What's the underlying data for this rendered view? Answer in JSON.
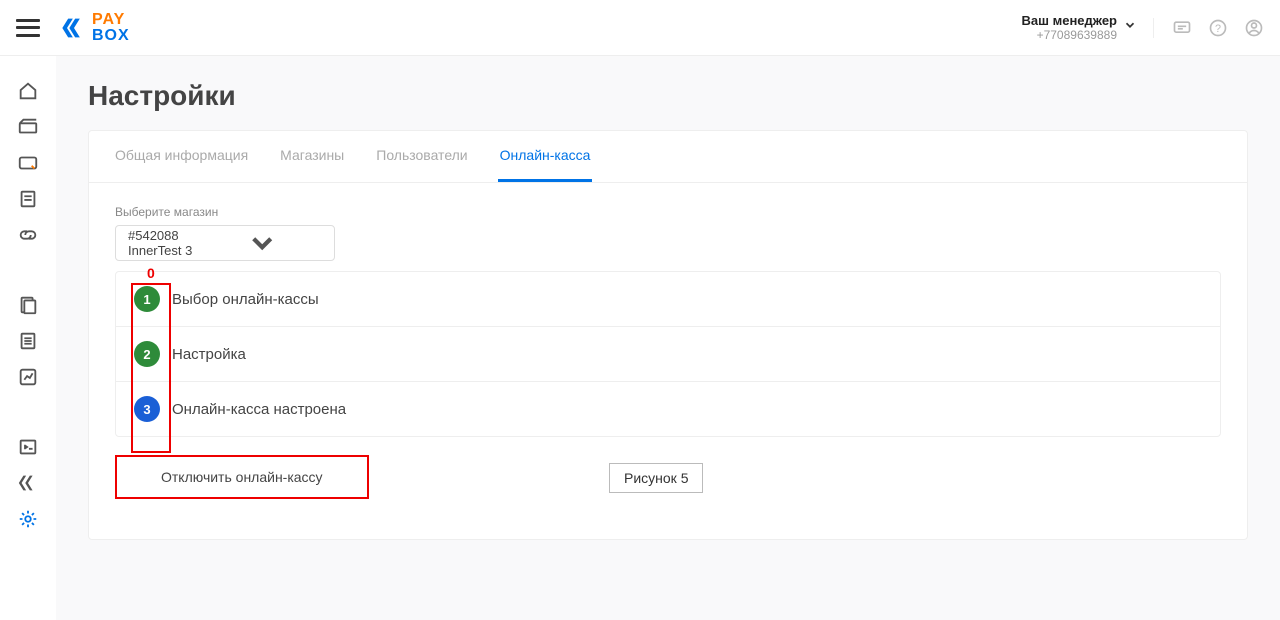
{
  "header": {
    "logo": {
      "pay": "PAY",
      "box": "BOX"
    },
    "manager_label": "Ваш менеджер",
    "manager_phone": "+77089639889"
  },
  "page": {
    "title": "Настройки"
  },
  "tabs": [
    {
      "label": "Общая информация"
    },
    {
      "label": "Магазины"
    },
    {
      "label": "Пользователи"
    },
    {
      "label": "Онлайн-касса"
    }
  ],
  "shop_select": {
    "label": "Выберите магазин",
    "value": "#542088 InnerTest 3"
  },
  "steps": [
    {
      "num": "1",
      "label": "Выбор онлайн-кассы",
      "color": "green"
    },
    {
      "num": "2",
      "label": "Настройка",
      "color": "green"
    },
    {
      "num": "3",
      "label": "Онлайн-касса настроена",
      "color": "blue"
    }
  ],
  "disable_button": "Отключить онлайн-кассу",
  "annotation": {
    "zero": "0",
    "figure": "Рисунок 5"
  }
}
